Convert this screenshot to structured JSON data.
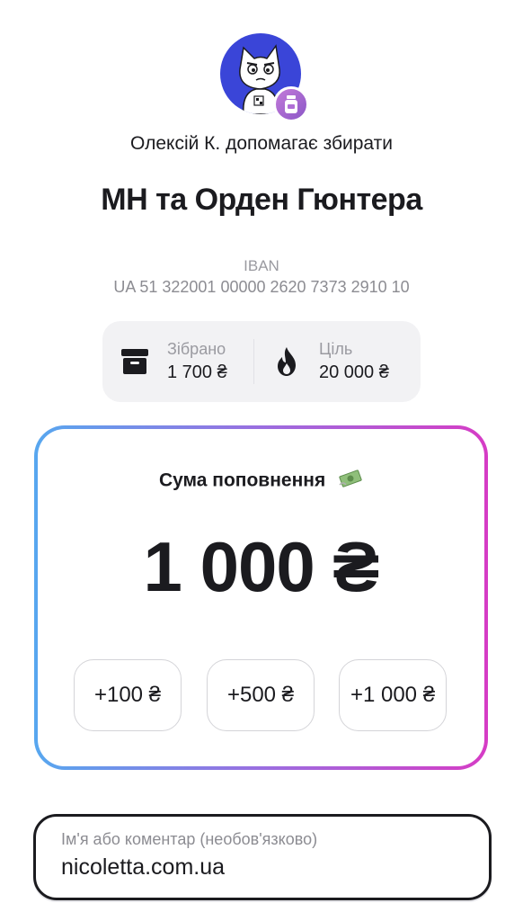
{
  "collector": {
    "text": "Олексій К. допомагає збирати"
  },
  "jar": {
    "title": "МН та Орден Гюнтера"
  },
  "iban": {
    "label": "IBAN",
    "value": "UA 51 322001 00000 2620 7373 2910 10"
  },
  "stats": {
    "collected": {
      "label": "Зібрано",
      "value": "1 700 ₴",
      "icon": "archive-box-icon"
    },
    "goal": {
      "label": "Ціль",
      "value": "20 000 ₴",
      "icon": "flame-icon"
    }
  },
  "topup": {
    "title": "Сума поповнення",
    "amount": "1 000 ₴",
    "quick_amounts": [
      "+100 ₴",
      "+500 ₴",
      "+1 000 ₴"
    ],
    "gradient": [
      "#57a7ef",
      "#9a6ee0",
      "#d63cc5"
    ]
  },
  "comment": {
    "placeholder": "Ім'я або коментар (необов'язково)",
    "value": "nicoletta.com.ua"
  },
  "colors": {
    "avatar_bg": "#3a45d8",
    "badge": "#a865d0",
    "text": "#1b1b1f",
    "muted": "#9a9aa0"
  }
}
